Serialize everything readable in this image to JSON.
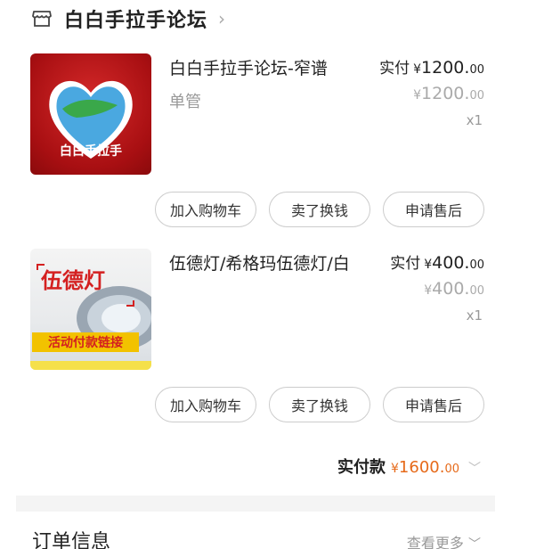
{
  "store": {
    "name": "白白手拉手论坛"
  },
  "items": [
    {
      "thumb_text": "白白手拉手",
      "title": "白白手拉手论坛-窄谱",
      "spec": "单管",
      "paid_label": "实付",
      "paid_int": "1200.",
      "paid_dec": "00",
      "orig_int": "1200.",
      "orig_dec": "00",
      "qty": "x1",
      "buttons": [
        "加入购物车",
        "卖了换钱",
        "申请售后"
      ]
    },
    {
      "thumb_title": "伍德灯",
      "thumb_sub": "活动付款链接",
      "title": "伍德灯/希格玛伍德灯/白",
      "spec": "",
      "paid_label": "实付",
      "paid_int": "400.",
      "paid_dec": "00",
      "orig_int": "400.",
      "orig_dec": "00",
      "qty": "x1",
      "buttons": [
        "加入购物车",
        "卖了换钱",
        "申请售后"
      ]
    }
  ],
  "currency": "¥",
  "total": {
    "label": "实付款",
    "int": "1600.",
    "dec": "00"
  },
  "order_info": {
    "title": "订单信息",
    "view_more": "查看更多"
  },
  "colors": {
    "accent": "#e66a1a",
    "muted": "#999999"
  }
}
